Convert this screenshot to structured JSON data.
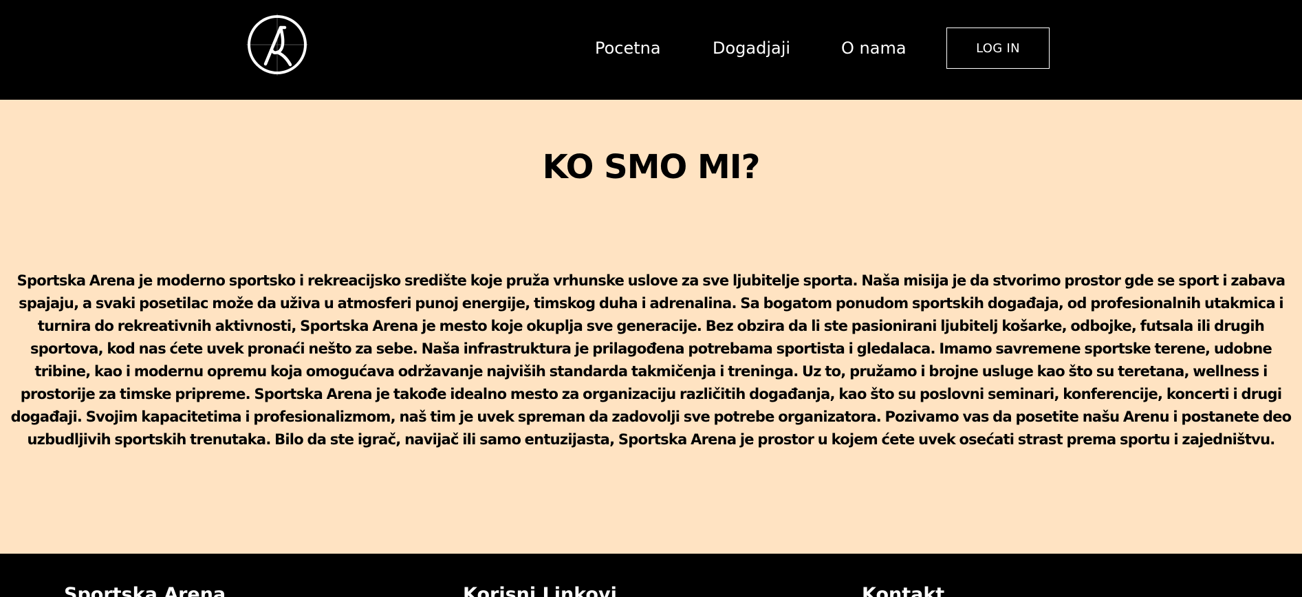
{
  "colors": {
    "header_bg": "#000000",
    "page_bg": "#ffe3c2",
    "footer_bg": "#000000",
    "text_light": "#ffffff",
    "text_dark": "#000000"
  },
  "header": {
    "logo_icon": "arena-logo-icon",
    "nav": {
      "home": "Pocetna",
      "events": "Dogadjaji",
      "about": "O nama"
    },
    "login_label": "LOG IN"
  },
  "about": {
    "title": "KO SMO MI?",
    "body": "Sportska Arena je moderno sportsko i rekreacijsko središte koje pruža vrhunske uslove za sve ljubitelje sporta. Naša misija je da stvorimo prostor gde se sport i zabava spajaju, a svaki posetilac može da uživa u atmosferi punoj energije, timskog duha i adrenalina. Sa bogatom ponudom sportskih događaja, od profesionalnih utakmica i turnira do rekreativnih aktivnosti, Sportska Arena je mesto koje okuplja sve generacije. Bez obzira da li ste pasionirani ljubitelj košarke, odbojke, futsala ili drugih sportova, kod nas ćete uvek pronaći nešto za sebe. Naša infrastruktura je prilagođena potrebama sportista i gledalaca. Imamo savremene sportske terene, udobne tribine, kao i modernu opremu koja omogućava održavanje najviših standarda takmičenja i treninga. Uz to, pružamo i brojne usluge kao što su teretana, wellness i prostorije za timske pripreme. Sportska Arena je takođe idealno mesto za organizaciju različitih događanja, kao što su poslovni seminari, konferencije, koncerti i drugi događaji. Svojim kapacitetima i profesionalizmom, naš tim je uvek spreman da zadovolji sve potrebe organizatora. Pozivamo vas da posetite našu Arenu i postanete deo uzbudljivih sportskih trenutaka. Bilo da ste igrač, navijač ili samo entuzijasta, Sportska Arena je prostor u kojem ćete uvek osećati strast prema sportu i zajedništvu."
  },
  "footer": {
    "brand_heading": "Sportska Arena",
    "links_heading": "Korisni Linkovi",
    "contact_heading": "Kontakt"
  }
}
